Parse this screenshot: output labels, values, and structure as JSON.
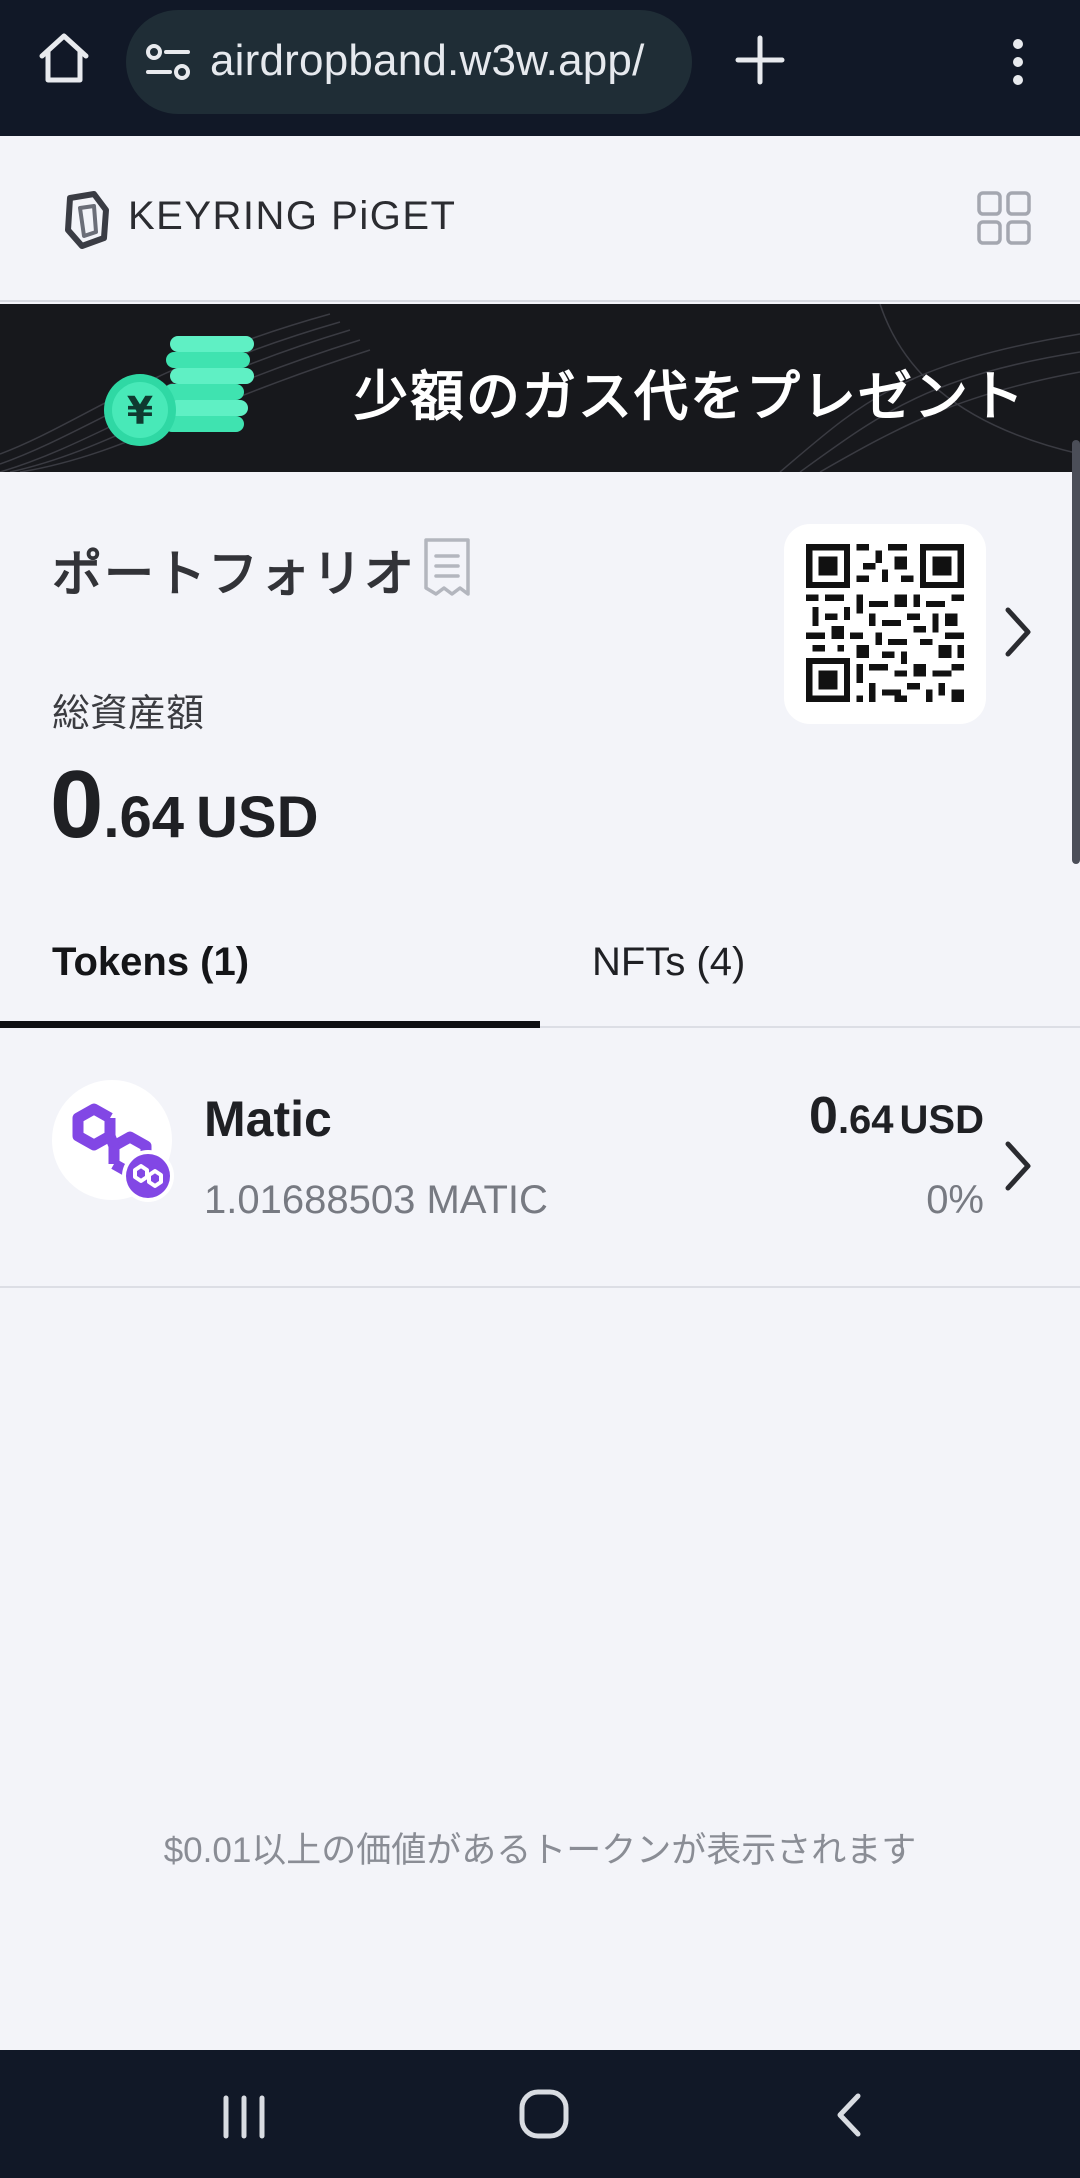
{
  "browser": {
    "url": "airdropband.w3w.app/"
  },
  "header": {
    "logo_text": "KEYRING PiGET"
  },
  "banner": {
    "text": "少額のガス代をプレゼント"
  },
  "portfolio": {
    "title": "ポートフォリオ",
    "total_label": "総資産額",
    "total_int": "0",
    "total_dec": ".64",
    "total_currency": "USD"
  },
  "tabs": [
    {
      "label": "Tokens (1)",
      "active": true
    },
    {
      "label": "NFTs (4)",
      "active": false
    }
  ],
  "tokens": [
    {
      "name": "Matic",
      "amount": "1.01688503 MATIC",
      "value_int": "0",
      "value_dec": ".64",
      "value_currency": "USD",
      "change": "0%",
      "icon": "polygon-icon"
    }
  ],
  "footer_note": "$0.01以上の価値があるトークンが表示されます",
  "colors": {
    "browser_bg": "#111827",
    "page_bg": "#f3f4f9",
    "banner_bg": "#17181c",
    "polygon_purple": "#8247e5",
    "coin_green": "#3fe3b0"
  }
}
